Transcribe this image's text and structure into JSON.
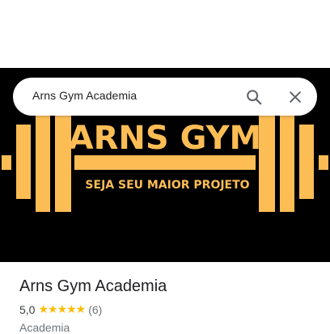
{
  "search": {
    "query": "Arns Gym Academia",
    "search_icon": "search-icon",
    "clear_icon": "close-icon"
  },
  "hero": {
    "brand": "ARNS GYM",
    "slogan": "SEJA SEU MAIOR PROJETO",
    "background_color": "#000000",
    "accent_color": "#fdbd55"
  },
  "place": {
    "name": "Arns Gym Academia",
    "rating": "5,0",
    "stars": "★★★★★",
    "review_count": "(6)",
    "category": "Academia"
  }
}
